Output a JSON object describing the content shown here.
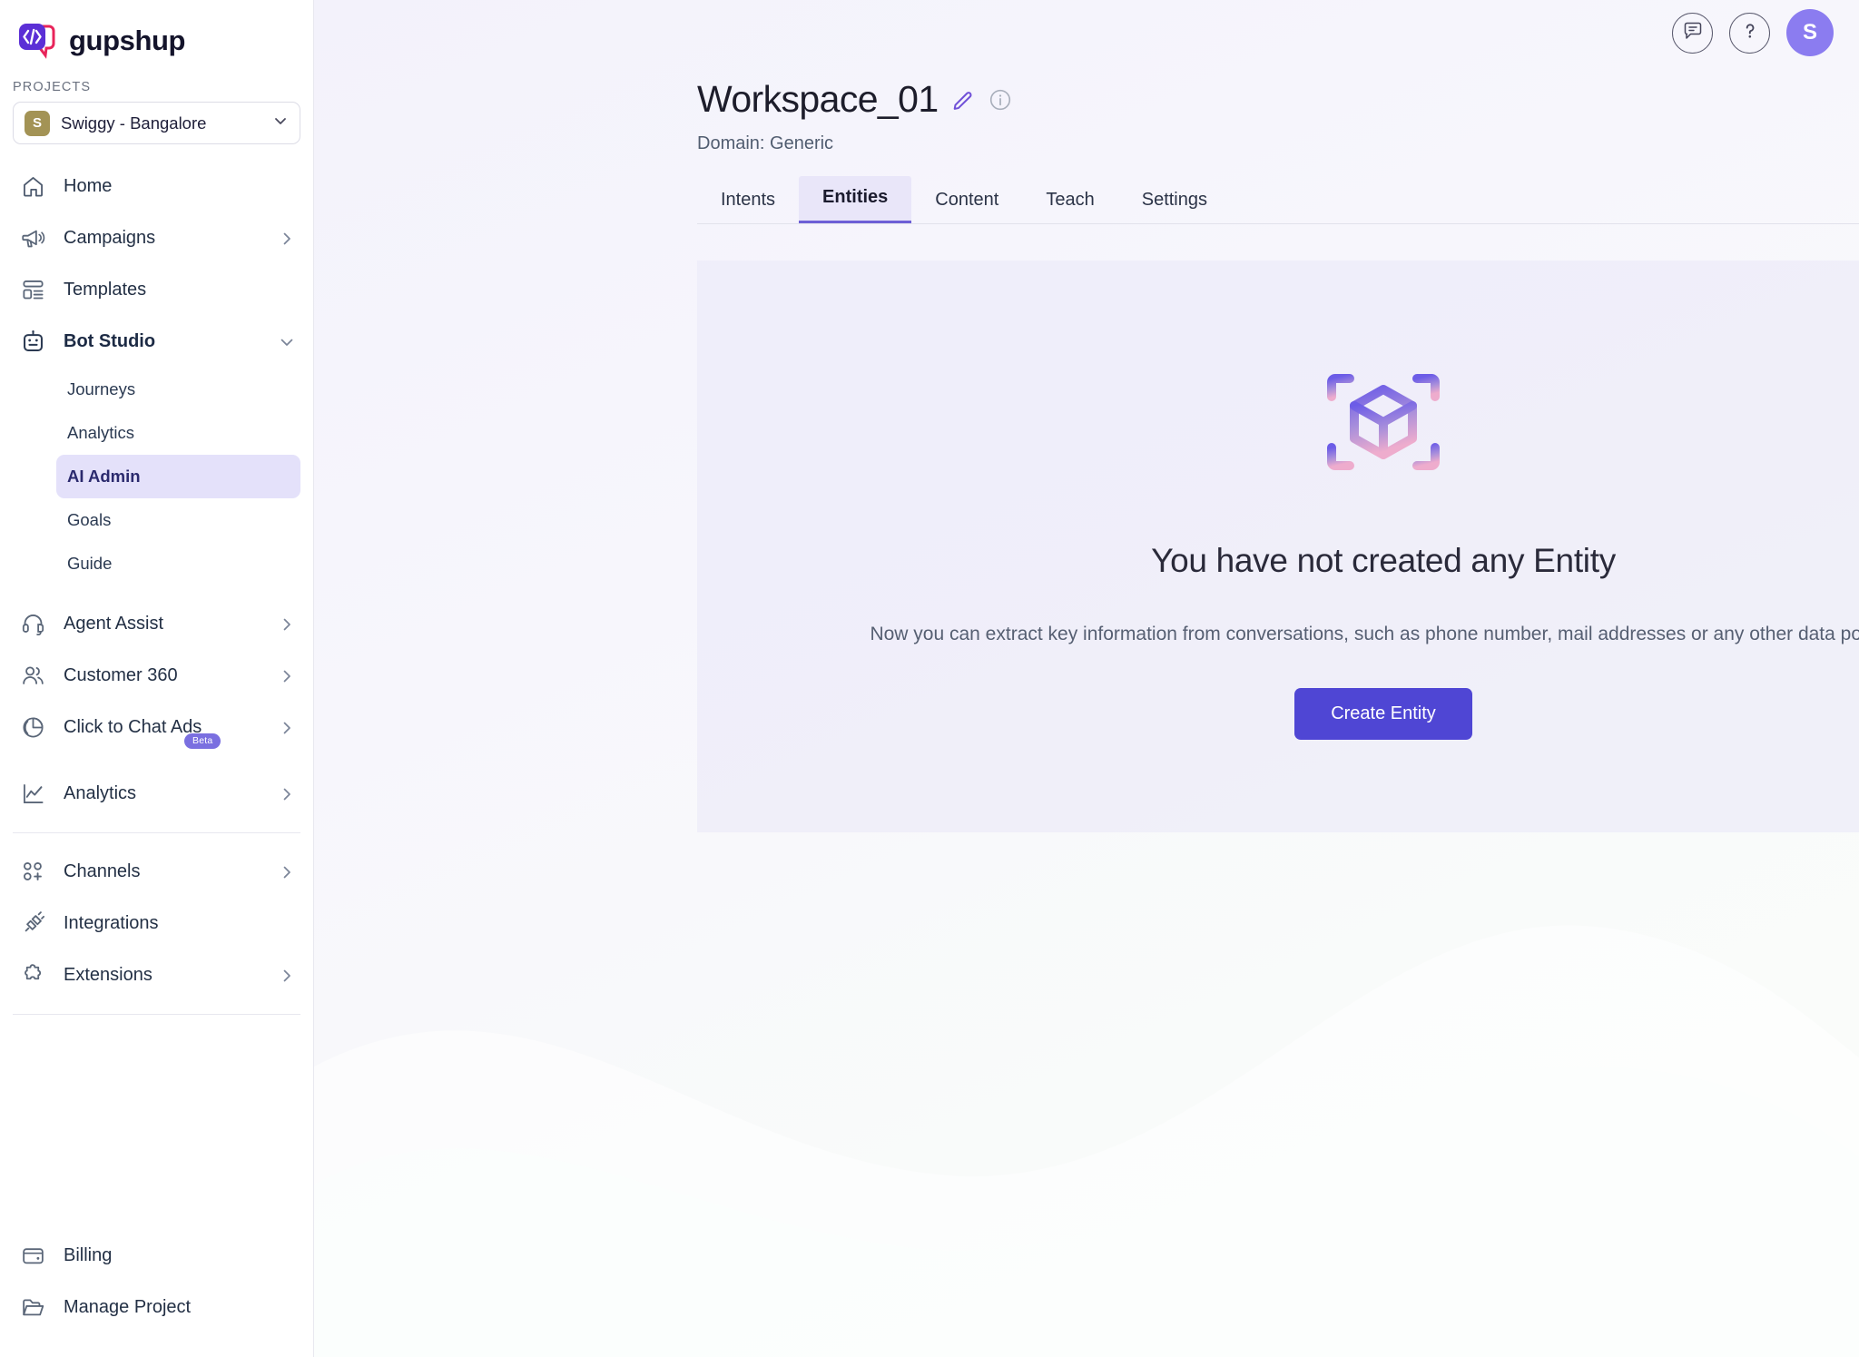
{
  "brand": {
    "name": "gupshup",
    "logo_icon": "gupshup-code-bubble-logo"
  },
  "sidebar": {
    "projects_label": "PROJECTS",
    "project": {
      "initial": "S",
      "name": "Swiggy - Bangalore",
      "chevron_icon": "chevron-down-icon"
    },
    "items": [
      {
        "label": "Home",
        "icon": "home-icon",
        "chevron": false
      },
      {
        "label": "Campaigns",
        "icon": "megaphone-icon",
        "chevron": true
      },
      {
        "label": "Templates",
        "icon": "templates-icon",
        "chevron": false
      },
      {
        "label": "Bot Studio",
        "icon": "robot-icon",
        "chevron": true,
        "expanded": true
      },
      {
        "label": "Agent Assist",
        "icon": "headset-icon",
        "chevron": true
      },
      {
        "label": "Customer 360",
        "icon": "users-icon",
        "chevron": true
      },
      {
        "label": "Click to Chat Ads",
        "icon": "pie-chart-icon",
        "chevron": true,
        "badge": "Beta"
      },
      {
        "label": "Analytics",
        "icon": "line-chart-icon",
        "chevron": true
      }
    ],
    "bot_studio_children": [
      {
        "label": "Journeys",
        "active": false
      },
      {
        "label": "Analytics",
        "active": false
      },
      {
        "label": "AI Admin",
        "active": true
      },
      {
        "label": "Goals",
        "active": false
      },
      {
        "label": "Guide",
        "active": false
      }
    ],
    "group2": [
      {
        "label": "Channels",
        "icon": "channels-icon",
        "chevron": true
      },
      {
        "label": "Integrations",
        "icon": "plug-icon",
        "chevron": false
      },
      {
        "label": "Extensions",
        "icon": "puzzle-icon",
        "chevron": true
      }
    ],
    "group3": [
      {
        "label": "Billing",
        "icon": "wallet-icon",
        "chevron": false
      },
      {
        "label": "Manage Project",
        "icon": "folder-icon",
        "chevron": false
      }
    ]
  },
  "topbar": {
    "feedback_icon": "chat-bubble-icon",
    "help_icon": "question-mark-icon",
    "avatar_initial": "S",
    "avatar_color": "#8b7cf0"
  },
  "header": {
    "workspace_title": "Workspace_01",
    "edit_icon": "pencil-icon",
    "info_icon": "info-circle-icon",
    "domain_text": "Domain: Generic"
  },
  "tabs": [
    {
      "label": "Intents",
      "active": false
    },
    {
      "label": "Entities",
      "active": true
    },
    {
      "label": "Content",
      "active": false
    },
    {
      "label": "Teach",
      "active": false
    },
    {
      "label": "Settings",
      "active": false
    }
  ],
  "empty_state": {
    "illustration_icon": "cube-scan-icon",
    "title": "You have not created any Entity",
    "description": "Now you can extract key information from conversations, such as phone number, mail addresses or any other data points.",
    "button_label": "Create Entity",
    "button_color": "#4f46d4"
  }
}
